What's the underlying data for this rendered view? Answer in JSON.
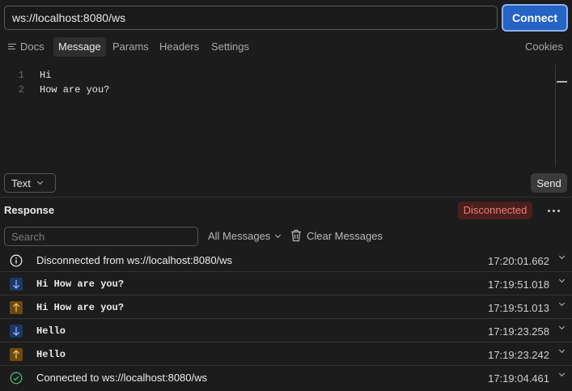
{
  "connection": {
    "url": "ws://localhost:8080/ws",
    "connect_label": "Connect"
  },
  "tabs": {
    "docs": "Docs",
    "message": "Message",
    "params": "Params",
    "headers": "Headers",
    "settings": "Settings",
    "cookies": "Cookies"
  },
  "editor": {
    "lines": [
      {
        "number": "1",
        "text": "Hi"
      },
      {
        "number": "2",
        "text": "How are you?"
      }
    ]
  },
  "composer": {
    "format_label": "Text",
    "send_label": "Send"
  },
  "response": {
    "title": "Response",
    "status": "Disconnected",
    "search_placeholder": "Search",
    "filter_label": "All Messages",
    "clear_label": "Clear Messages",
    "messages": [
      {
        "kind": "info",
        "icon": "info-icon",
        "text": "Disconnected from ws://localhost:8080/ws",
        "time": "17:20:01.662"
      },
      {
        "kind": "received",
        "icon": "arrow-down-icon",
        "text": "Hi How are you?",
        "time": "17:19:51.018"
      },
      {
        "kind": "sent",
        "icon": "arrow-up-icon",
        "text": "Hi How are you?",
        "time": "17:19:51.013"
      },
      {
        "kind": "received",
        "icon": "arrow-down-icon",
        "text": "Hello",
        "time": "17:19:23.258"
      },
      {
        "kind": "sent",
        "icon": "arrow-up-icon",
        "text": "Hello",
        "time": "17:19:23.242"
      },
      {
        "kind": "connected",
        "icon": "check-circle-icon",
        "text": "Connected to ws://localhost:8080/ws",
        "time": "17:19:04.461"
      }
    ]
  },
  "colors": {
    "accent": "#2563c4",
    "status_error_bg": "#4a1f1c",
    "status_error_text": "#ef7e73",
    "received_bg": "#1d3766",
    "sent_bg": "#6b4a10",
    "connected": "#4caf7a"
  }
}
